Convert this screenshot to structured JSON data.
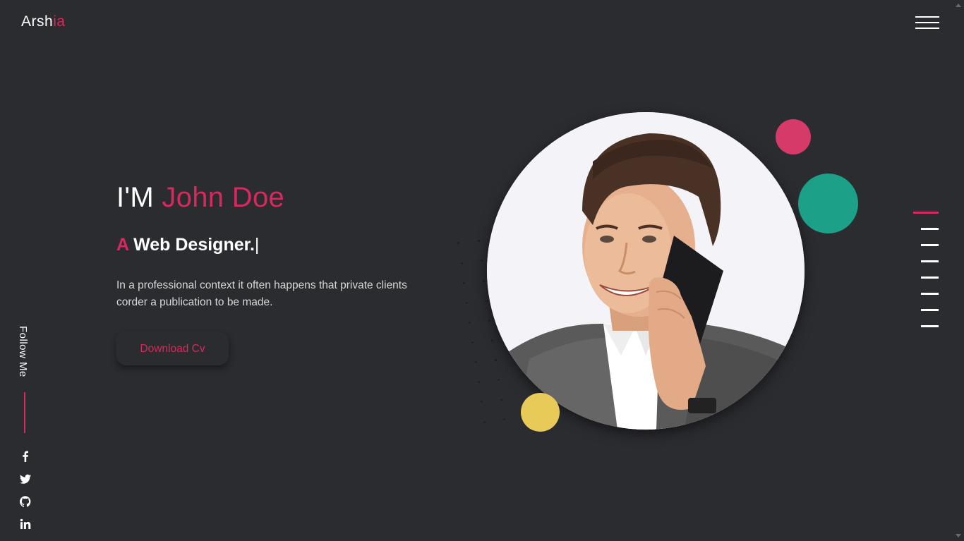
{
  "header": {
    "logo_main": "Arsh",
    "logo_accent": "ia",
    "menu_icon": "hamburger-icon"
  },
  "hero": {
    "greeting": "I'M",
    "name": "John Doe",
    "subtitle_article": "A",
    "subtitle_role": "Web Designer.",
    "subtitle_cursor": "|",
    "description": "In a professional context it often happens that private clients corder a publication to be made.",
    "cta_label": "Download Cv"
  },
  "social": {
    "follow_label": "Follow Me",
    "icons": [
      "facebook-icon",
      "twitter-icon",
      "github-icon",
      "linkedin-icon"
    ]
  },
  "side_nav": {
    "items": 7,
    "active_index": 0
  },
  "colors": {
    "background": "#2b2c30",
    "accent": "#d6295d",
    "pink_circle": "#d63a68",
    "green_circle": "#1da088",
    "yellow_circle": "#e8ca58"
  }
}
